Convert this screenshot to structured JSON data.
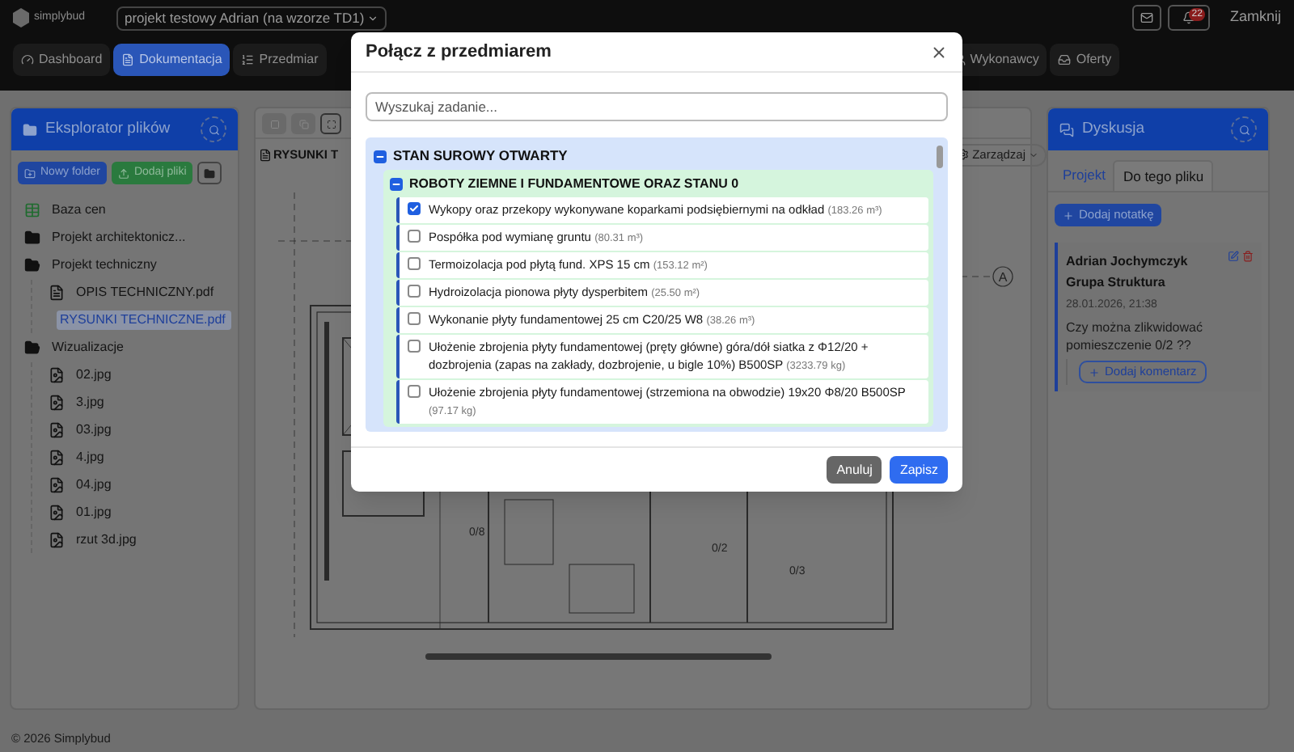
{
  "header": {
    "logo": "simplybud",
    "project_select": "projekt testowy Adrian (na wzorze TD1)",
    "notification_count": "22",
    "close_label": "Zamknij"
  },
  "nav_tabs": [
    {
      "label": "Dashboard",
      "selected": false
    },
    {
      "label": "Dokumentacja",
      "selected": true
    },
    {
      "label": "Przedmiar",
      "selected": false
    },
    {
      "label": "Wykonawcy",
      "selected": false
    },
    {
      "label": "Oferty",
      "selected": false
    }
  ],
  "file_explorer": {
    "title": "Eksplorator plików",
    "buttons": [
      "Nowy folder",
      "Dodaj pliki"
    ],
    "items": [
      {
        "label": "Baza cen",
        "kind": "pricebook",
        "selected": false
      },
      {
        "label": "Projekt architektonicz...",
        "kind": "folder",
        "expanded": false,
        "selected": false
      },
      {
        "label": "Projekt techniczny",
        "kind": "folder",
        "expanded": true,
        "selected": false,
        "children": [
          {
            "label": "OPIS TECHNICZNY.pdf",
            "kind": "pdf",
            "selected": false
          },
          {
            "label": "RYSUNKI TECHNICZNE.pdf",
            "kind": "pdf",
            "selected": true
          }
        ]
      },
      {
        "label": "Wizualizacje",
        "kind": "folder",
        "expanded": true,
        "selected": false,
        "children": [
          {
            "label": "02.jpg",
            "kind": "image",
            "selected": false
          },
          {
            "label": "3.jpg",
            "kind": "image",
            "selected": false
          },
          {
            "label": "03.jpg",
            "kind": "image",
            "selected": false
          },
          {
            "label": "4.jpg",
            "kind": "image",
            "selected": false
          },
          {
            "label": "04.jpg",
            "kind": "image",
            "selected": false
          },
          {
            "label": "01.jpg",
            "kind": "image",
            "selected": false
          },
          {
            "label": "rzut 3d.jpg",
            "kind": "image",
            "selected": false
          }
        ]
      }
    ]
  },
  "viewer": {
    "title": "RYSUNKI T",
    "manage_button": "Zarządzaj",
    "drawing_labels": [
      "A",
      "0/8",
      "0/2",
      "0/3"
    ]
  },
  "discussion": {
    "title": "Dyskusja",
    "tabs": [
      {
        "label": "Projekt",
        "selected": false
      },
      {
        "label": "Do tego pliku",
        "selected": true
      }
    ],
    "add_note": "Dodaj notatkę",
    "notes": [
      {
        "author": "Adrian Jochymczyk Grupa Struktura",
        "date": "28.01.2026, 21:38",
        "text": "Czy można zlikwidować pomieszczenie 0/2 ??",
        "add_comment": "Dodaj komentarz"
      }
    ]
  },
  "modal": {
    "title": "Połącz z przedmiarem",
    "search": {
      "placeholder": "Wyszukaj zadanie..."
    },
    "groups": [
      {
        "label": "STAN SUROWY OTWARTY",
        "expanded": true,
        "children": [
          {
            "label": "ROBOTY ZIEMNE I FUNDAMENTOWE ORAZ STANU 0",
            "expanded": true,
            "tasks": [
              {
                "label": "Wykopy oraz przekopy wykonywane koparkami podsiębiernymi na odkład",
                "quantity": "(183.26 m³)",
                "checked": true
              },
              {
                "label": "Pospółka pod wymianę gruntu",
                "quantity": "(80.31 m³)",
                "checked": false
              },
              {
                "label": "Termoizolacja pod płytą fund. XPS 15 cm",
                "quantity": "(153.12 m²)",
                "checked": false
              },
              {
                "label": "Hydroizolacja pionowa płyty dysperbitem",
                "quantity": "(25.50 m²)",
                "checked": false
              },
              {
                "label": "Wykonanie płyty fundamentowej 25 cm C20/25 W8",
                "quantity": "(38.26 m³)",
                "checked": false
              },
              {
                "label": "Ułożenie zbrojenia płyty fundamentowej (pręty główne) góra/dół siatka z Φ12/20 + dozbrojenia (zapas na zakłady, dozbrojenie, u bigle 10%) B500SP",
                "quantity": "(3233.79 kg)",
                "checked": false
              },
              {
                "label": "Ułożenie zbrojenia płyty fundamentowej (strzemiona na obwodzie) 19x20 Φ8/20 B500SP",
                "quantity": "(97.17 kg)",
                "checked": false
              }
            ]
          }
        ]
      }
    ],
    "buttons": [
      {
        "label": "Anuluj",
        "kind": "secondary"
      },
      {
        "label": "Zapisz",
        "kind": "primary"
      }
    ]
  },
  "footer": "© 2026 Simplybud"
}
